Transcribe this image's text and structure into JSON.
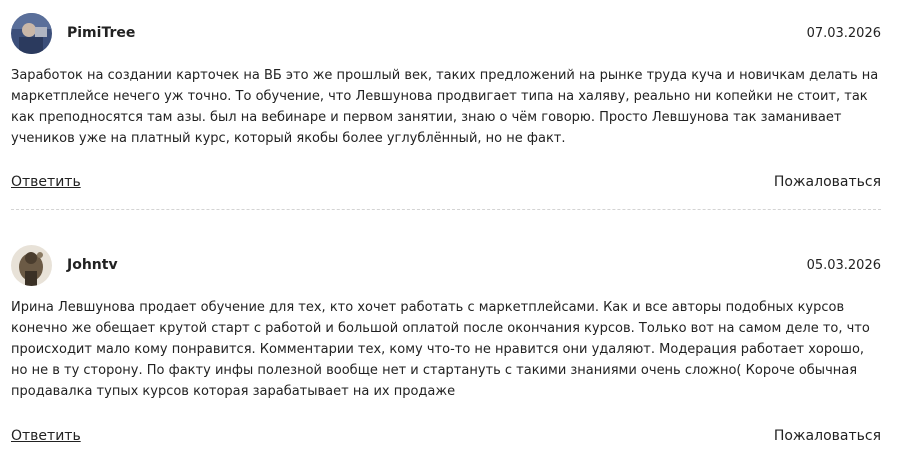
{
  "comments": [
    {
      "author": "PimiTree",
      "date": "07.03.2026",
      "text": "Заработок на создании карточек на ВБ это же прошлый век, таких предложений на рынке труда куча и новичкам делать на маркетплейсе нечего уж точно. То обучение, что Левшунова продвигает типа на халяву, реально ни копейки не стоит, так как преподносятся там азы. был на вебинаре и первом занятии, знаю о чём говорю. Просто Левшунова так заманивает учеников уже на платный курс, который якобы более углублённый, но не факт.",
      "reply_label": "Ответить",
      "report_label": "Пожаловаться"
    },
    {
      "author": "Johntv",
      "date": "05.03.2026",
      "text": "Ирина Левшунова продает обучение для тех, кто хочет работать с маркетплейсами. Как и все авторы подобных курсов конечно же обещает крутой старт с работой и большой оплатой после окончания курсов. Только вот на самом деле то, что происходит мало кому понравится. Комментарии тех, кому что-то не нравится они удаляют. Модерация работает хорошо, но не в ту сторону. По факту инфы полезной вообще нет и стартануть с такими знаниями очень сложно( Короче обычная продавалка тупых курсов которая зарабатывает на их продаже",
      "reply_label": "Ответить",
      "report_label": "Пожаловаться"
    }
  ]
}
